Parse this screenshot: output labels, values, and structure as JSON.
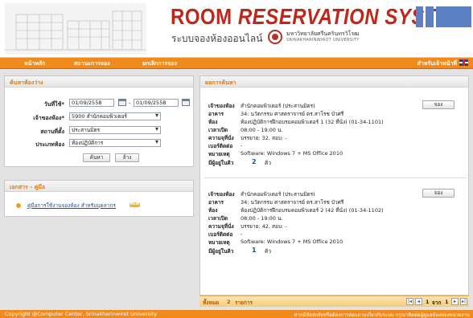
{
  "header": {
    "title_part1": "ROOM",
    "title_part2": "RESERVATION SYSTEM",
    "subtitle": "ระบบจองห้องออนไลน์",
    "university_th": "มหาวิทยาลัยศรีนครินทรวิโรฒ",
    "university_en": "SRINAKHARINWIROT UNIVERSITY"
  },
  "nav": {
    "items": [
      {
        "label": "หน้าหลัก"
      },
      {
        "label": "สถานะการจอง"
      },
      {
        "label": "ยกเลิกการจอง"
      }
    ],
    "staff_link": "สำหรับเจ้าหน้าที่"
  },
  "search": {
    "title": "ค้นหาห้องว่าง",
    "date_label": "วันที่ใช้*",
    "date_from": "01/09/2558",
    "date_sep": "-",
    "date_to": "01/09/2558",
    "owner_label": "เจ้าของห้อง*",
    "owner_value": "5900 สำนักคอมพิวเตอร์",
    "location_label": "สถานที่ตั้ง",
    "location_value": "ประสานมิตร",
    "room_type_label": "ประเภทห้อง",
    "room_type_value": "ห้องปฏิบัติการ",
    "search_button": "ค้นหา",
    "clear_button": "ล้าง"
  },
  "docs": {
    "title": "เอกสาร - คู่มือ",
    "items": [
      {
        "label": "คู่มือการใช้งานจองห้อง สำหรับบุคลากร",
        "badge": "NEW"
      }
    ]
  },
  "results": {
    "title": "ผลการค้นหา",
    "labels": {
      "owner": "เจ้าของห้อง",
      "building": "อาคาร",
      "room": "ห้อง",
      "hours": "เวลาเปิด",
      "capacity": "ความจุที่นั่ง",
      "phone": "เบอร์ติดต่อ",
      "note": "หมายเหตุ",
      "queue": "มีผู้อยู่ในคิว",
      "queue_unit": "คิว"
    },
    "reserve_label": "จอง",
    "items": [
      {
        "owner": "สำนักคอมพิวเตอร์ (ประสานมิตร)",
        "building": "34: นวัตกรรม ศาสตราจารย์ ดร.สาโรช บัวศรี",
        "room": "ห้องปฏิบัติการฝึกอบรมคอมพิวเตอร์ 1 (32 ที่นั่ง) (01-34-1101)",
        "hours": "08:00 - 19:00 น.",
        "capacity": "บรรยาย: 32, สอบ: -",
        "phone": "-",
        "note": "Software: Windows 7 + MS Office 2010",
        "queue": "2"
      },
      {
        "owner": "สำนักคอมพิวเตอร์ (ประสานมิตร)",
        "building": "34: นวัตกรรม ศาสตราจารย์ ดร.สาโรช บัวศรี",
        "room": "ห้องปฏิบัติการฝึกอบรมคอมพิวเตอร์ 2 (42 ที่นั่ง) (01-34-1102)",
        "hours": "08:00 - 19:00 น.",
        "capacity": "บรรยาย: 42, สอบ: -",
        "phone": "-",
        "note": "Software: Windows 7 + MS Office 2010",
        "queue": "1"
      }
    ],
    "total_label": "ทั้งหมด",
    "total_count": "2",
    "total_unit": "รายการ",
    "page_current": "1",
    "page_of": "จาก",
    "page_total": "1"
  },
  "footer": {
    "copyright": "Copyright @Computer Center, Srinakharinwirot University",
    "notice": "หากมีข้อสงสัยหรือต้องการสอบถามเกี่ยวกับระบบ กรุณาติดต่อผู้ดูแลห้องของหน่วยงาน"
  },
  "colors": {
    "accent_orange": "#f08a1c",
    "title_red": "#c0271b",
    "header_blue": "#5c80c4",
    "link_blue": "#1d4f9c"
  }
}
